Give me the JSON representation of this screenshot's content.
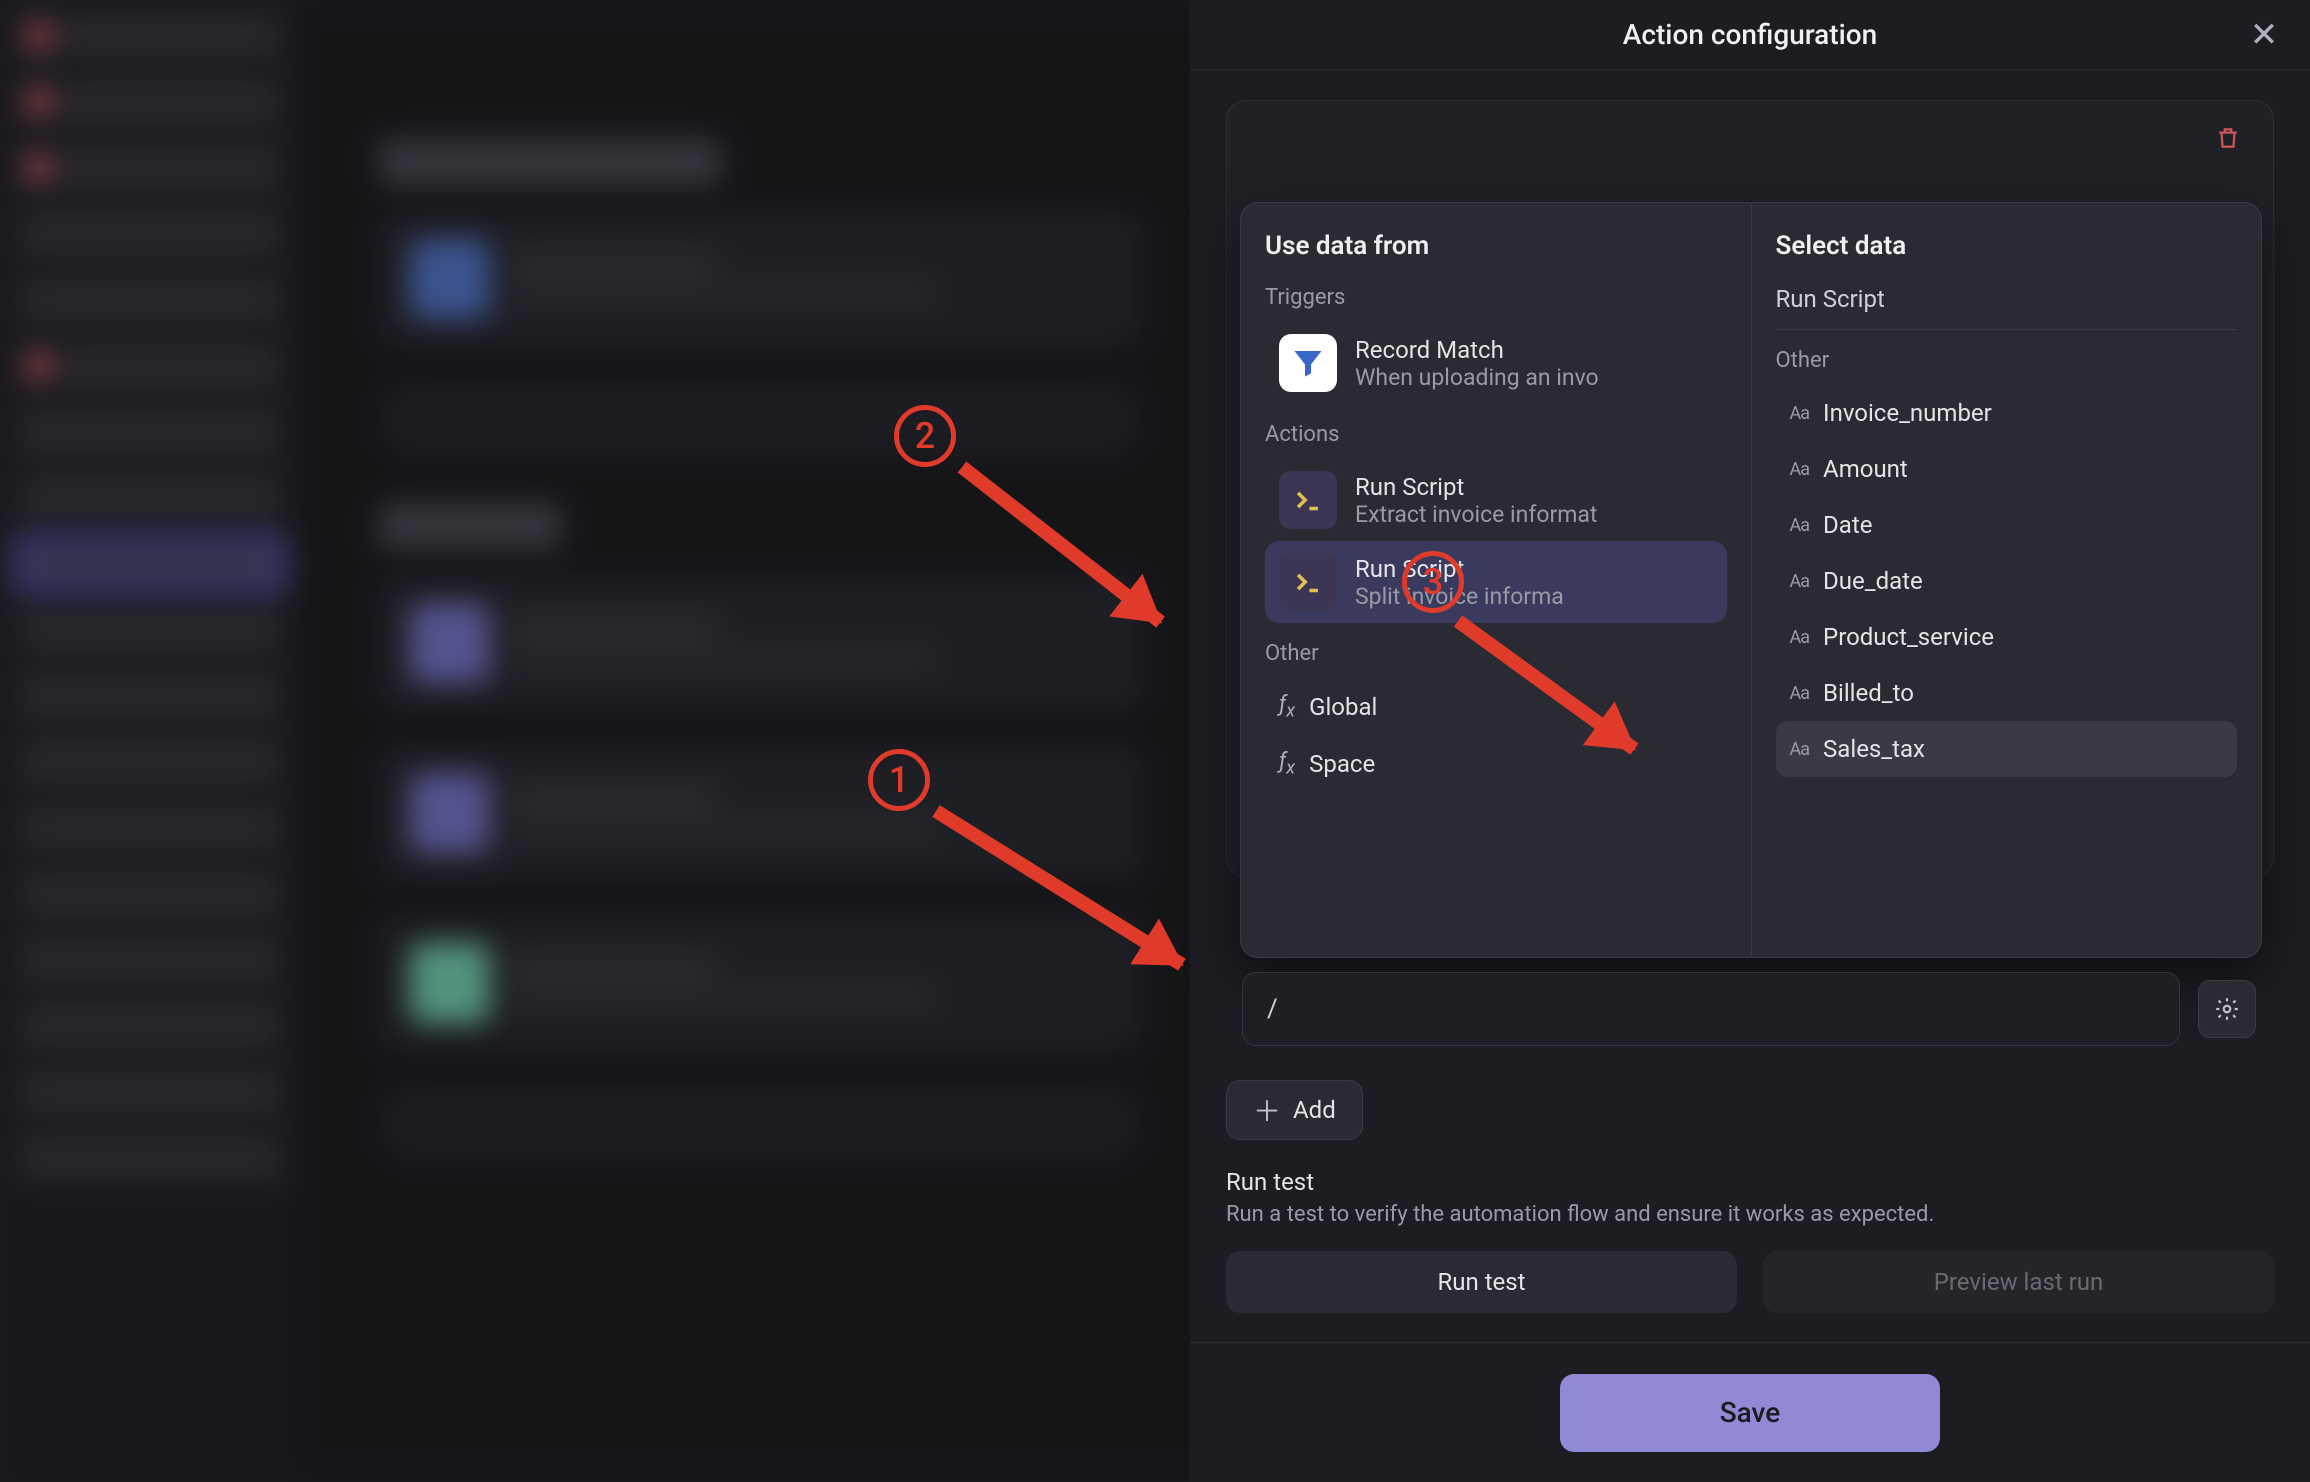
{
  "panel": {
    "title": "Action configuration",
    "save": "Save"
  },
  "popover": {
    "left_title": "Use data from",
    "groups": {
      "triggers": "Triggers",
      "actions": "Actions",
      "other": "Other"
    },
    "trigger": {
      "title": "Record Match",
      "sub": "When uploading an invo"
    },
    "actions": [
      {
        "title": "Run Script",
        "sub": "Extract invoice informat"
      },
      {
        "title": "Run Script",
        "sub": "Split invoice informa"
      }
    ],
    "fns": {
      "global": "Global",
      "space": "Space"
    },
    "right_title": "Select data",
    "path": "Run Script",
    "other_label": "Other",
    "fields": [
      "Invoice_number",
      "Amount",
      "Date",
      "Due_date",
      "Product_service",
      "Billed_to",
      "Sales_tax"
    ]
  },
  "input": {
    "value": "/"
  },
  "add": {
    "label": "Add"
  },
  "runtest": {
    "heading": "Run test",
    "sub": "Run a test to verify the automation flow and ensure it works as expected.",
    "run": "Run test",
    "preview": "Preview last run"
  },
  "annotations": {
    "n1": "1",
    "n2": "2",
    "n3": "3"
  }
}
